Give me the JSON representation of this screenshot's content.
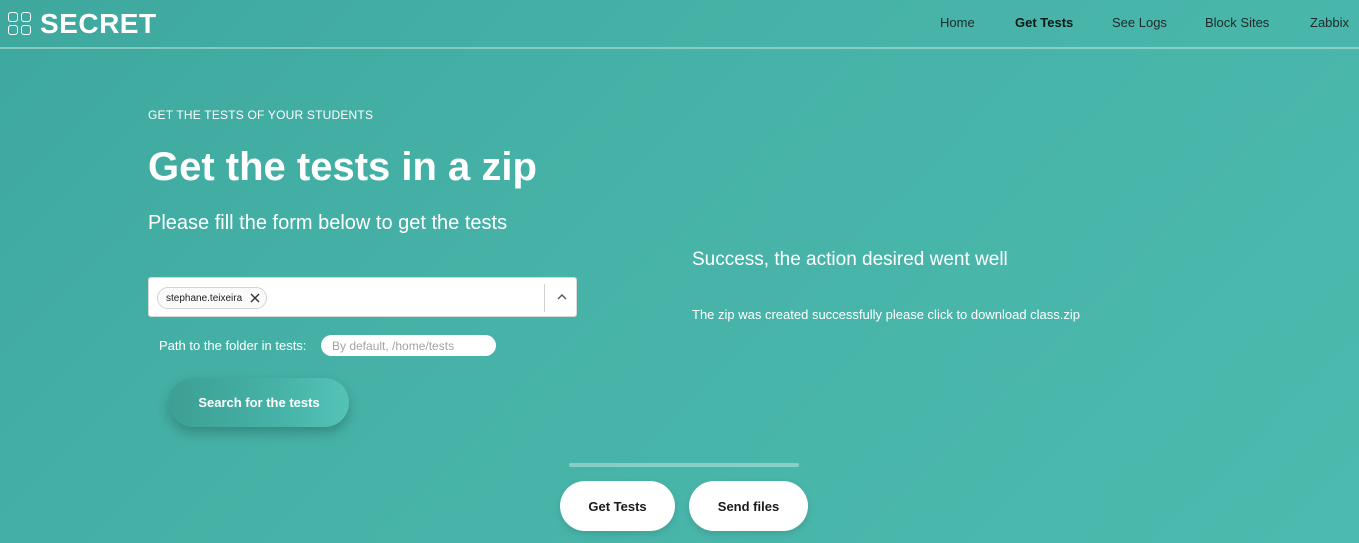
{
  "brand": {
    "name": "SECRET",
    "icon": "grid-icon"
  },
  "nav": {
    "items": [
      {
        "label": "Home",
        "active": false
      },
      {
        "label": "Get Tests",
        "active": true
      },
      {
        "label": "See Logs",
        "active": false
      },
      {
        "label": "Block Sites",
        "active": false
      },
      {
        "label": "Zabbix",
        "active": false
      }
    ]
  },
  "hero": {
    "eyebrow": "GET THE TESTS OF YOUR STUDENTS",
    "title": "Get the tests in a zip",
    "subtitle": "Please fill the form below to get the tests"
  },
  "form": {
    "selected_students": [
      "stephane.teixeira"
    ],
    "chip_remove_icon": "close-icon",
    "toggle_icon": "chevron-up-icon",
    "path_label": "Path to the folder in tests:",
    "path_value": "",
    "path_placeholder": "By default, /home/tests",
    "search_button": "Search for the tests"
  },
  "result": {
    "title": "Success, the action desired went well",
    "message": "The zip was created successfully please click to download class.zip"
  },
  "footer": {
    "buttons": [
      "Get Tests",
      "Send files"
    ]
  },
  "colors": {
    "background": "#45b0a5",
    "accent": "#ffffff",
    "nav_text": "#1d2b2a"
  }
}
